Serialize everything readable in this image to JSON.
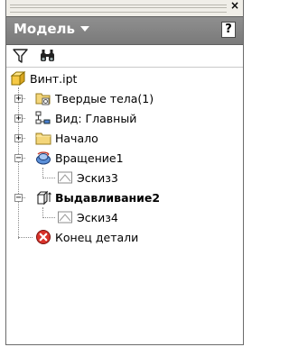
{
  "panel": {
    "title": "Модель",
    "close": "×",
    "help": "?"
  },
  "toolbar": {
    "filter_icon": "filter-icon",
    "find_icon": "binoculars-icon"
  },
  "tree": {
    "root": {
      "label": "Винт.ipt",
      "icon": "part-icon"
    },
    "items": [
      {
        "label": "Твердые тела(1)",
        "icon": "solid-bodies-folder-icon",
        "expander": "+"
      },
      {
        "label": "Вид: Главный",
        "icon": "view-rep-icon",
        "expander": "+"
      },
      {
        "label": "Начало",
        "icon": "origin-folder-icon",
        "expander": "+"
      },
      {
        "label": "Вращение1",
        "icon": "revolve-icon",
        "expander": "−",
        "children": [
          {
            "label": "Эскиз3",
            "icon": "sketch-icon"
          }
        ]
      },
      {
        "label": "Выдавливание2",
        "icon": "extrude-icon",
        "expander": "−",
        "bold": true,
        "children": [
          {
            "label": "Эскиз4",
            "icon": "sketch-icon"
          }
        ]
      },
      {
        "label": "Конец детали",
        "icon": "end-of-part-icon"
      }
    ]
  },
  "colors": {
    "title_bar": "#858585",
    "end_of_part": "#d8322a",
    "folder": "#f4d67a"
  }
}
